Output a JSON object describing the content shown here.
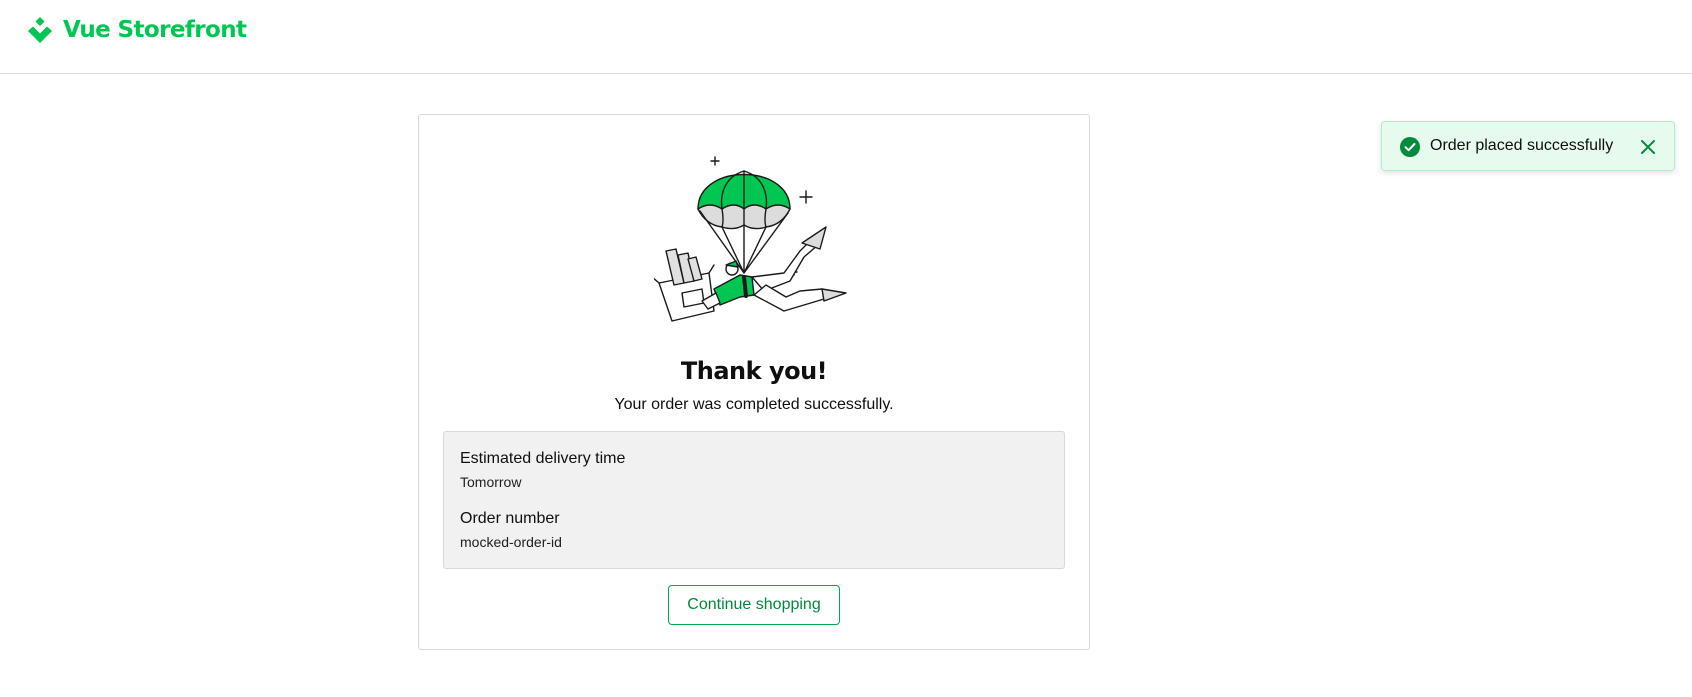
{
  "header": {
    "logo_text": "Vue Storefront",
    "logo_icon": "vue-storefront-logo-icon"
  },
  "confirmation": {
    "illustration": "parachute-delivery-illustration",
    "title": "Thank you!",
    "subtitle": "Your order was completed successfully.",
    "delivery_label": "Estimated delivery time",
    "delivery_value": "Tomorrow",
    "order_label": "Order number",
    "order_value": "mocked-order-id",
    "continue_label": "Continue shopping"
  },
  "toast": {
    "message": "Order placed successfully",
    "status_icon": "check-circle-icon",
    "close_icon": "close-icon"
  },
  "colors": {
    "brand": "#02c652",
    "primary_dark": "#008a3b",
    "success_bg": "#e6fbed"
  }
}
